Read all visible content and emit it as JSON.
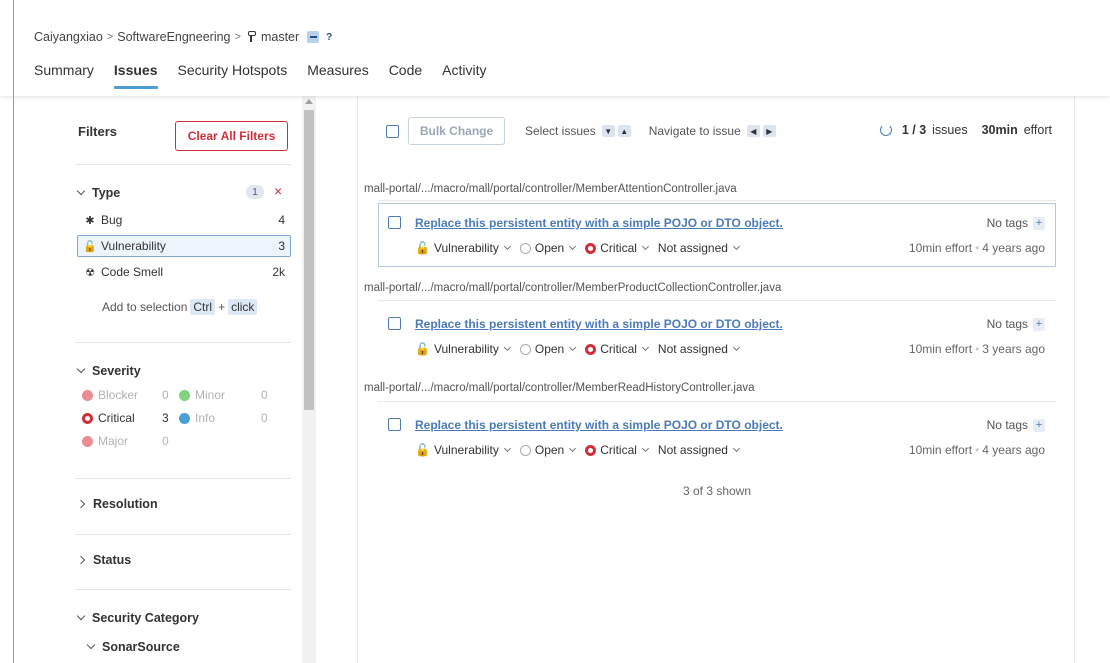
{
  "breadcrumb": {
    "owner": "Caiyangxiao",
    "project": "SoftwareEngneering",
    "branch": "master",
    "sep": ">",
    "help": "?"
  },
  "tabs": [
    {
      "label": "Summary"
    },
    {
      "label": "Issues"
    },
    {
      "label": "Security Hotspots"
    },
    {
      "label": "Measures"
    },
    {
      "label": "Code"
    },
    {
      "label": "Activity"
    }
  ],
  "sidebar": {
    "title": "Filters",
    "clear_label": "Clear All Filters",
    "type": {
      "title": "Type",
      "selected_count": "1",
      "remove": "×",
      "items": [
        {
          "label": "Bug",
          "count": "4",
          "icon": "bug-icon",
          "glyph": "✱"
        },
        {
          "label": "Vulnerability",
          "count": "3",
          "icon": "lock-icon",
          "glyph": "🔓"
        },
        {
          "label": "Code Smell",
          "count": "2k",
          "icon": "code-smell-icon",
          "glyph": "☢"
        }
      ],
      "hint_prefix": "Add to selection",
      "hint_key1": "Ctrl",
      "hint_plus": "+",
      "hint_key2": "click"
    },
    "severity": {
      "title": "Severity",
      "items": [
        {
          "label": "Blocker",
          "count": "0",
          "color": "#d02f3a",
          "muted": true
        },
        {
          "label": "Minor",
          "count": "0",
          "color": "#00aa00",
          "muted": true
        },
        {
          "label": "Critical",
          "count": "3",
          "color": "#d02f3a",
          "muted": false
        },
        {
          "label": "Info",
          "count": "0",
          "color": "#4b9fd5",
          "muted": true
        },
        {
          "label": "Major",
          "count": "0",
          "color": "#d02f3a",
          "muted": true
        }
      ]
    },
    "resolution": {
      "title": "Resolution"
    },
    "status": {
      "title": "Status"
    },
    "security_category": {
      "title": "Security Category",
      "sub": "SonarSource"
    }
  },
  "toolbar": {
    "bulk_change": "Bulk Change",
    "select_issues": "Select issues",
    "navigate": "Navigate to issue",
    "issues_count": "1 / 3",
    "issues_word": "issues",
    "effort_value": "30min",
    "effort_word": "effort"
  },
  "issues": [
    {
      "path": "mall-portal/.../macro/mall/portal/controller/MemberAttentionController.java",
      "message": "Replace this persistent entity with a simple POJO or DTO object.",
      "tags": "No tags",
      "type": "Vulnerability",
      "status": "Open",
      "severity": "Critical",
      "assignee": "Not assigned",
      "effort": "10min effort",
      "age": "4 years ago"
    },
    {
      "path": "mall-portal/.../macro/mall/portal/controller/MemberProductCollectionController.java",
      "message": "Replace this persistent entity with a simple POJO or DTO object.",
      "tags": "No tags",
      "type": "Vulnerability",
      "status": "Open",
      "severity": "Critical",
      "assignee": "Not assigned",
      "effort": "10min effort",
      "age": "3 years ago"
    },
    {
      "path": "mall-portal/.../macro/mall/portal/controller/MemberReadHistoryController.java",
      "message": "Replace this persistent entity with a simple POJO or DTO object.",
      "tags": "No tags",
      "type": "Vulnerability",
      "status": "Open",
      "severity": "Critical",
      "assignee": "Not assigned",
      "effort": "10min effort",
      "age": "4 years ago"
    }
  ],
  "shown_text": "3 of 3 shown",
  "colors": {
    "accent": "#4b7bb8",
    "danger": "#d02f3a",
    "tab_underline": "#4b9fd5"
  }
}
